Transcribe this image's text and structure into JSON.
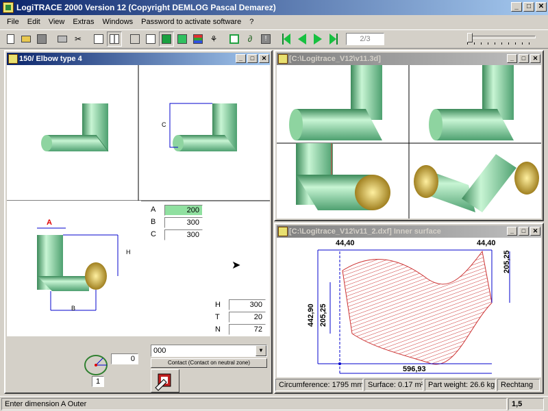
{
  "app": {
    "title": "LogiTRACE 2000  Version 12  (Copyright DEMLOG Pascal Demarez)",
    "window_buttons": {
      "minimize": "_",
      "maximize": "□",
      "close": "✕"
    }
  },
  "menu": [
    "File",
    "Edit",
    "View",
    "Extras",
    "Windows",
    "Password to activate software",
    "?"
  ],
  "toolbar": {
    "page_indicator": "2/3",
    "icons": [
      "new-file-icon",
      "open-folder-icon",
      "save-icon",
      "print-icon",
      "cut-icon",
      "page-view-icon",
      "grid-view-icon",
      "wireframe-cube-icon",
      "cube-icon",
      "shaded-cube-icon",
      "green-cube-icon",
      "colors-icon",
      "tree-icon",
      "frame-icon",
      "curve-icon",
      "info-icon"
    ]
  },
  "windows": {
    "elbow": {
      "title": "150/ Elbow type 4",
      "labels": {
        "c_view": "C",
        "a_view": "A",
        "h_view": "H",
        "b_view": "B"
      },
      "dimensions": [
        {
          "label": "A",
          "value": "200",
          "highlight": true
        },
        {
          "label": "B",
          "value": "300"
        },
        {
          "label": "C",
          "value": "300"
        }
      ],
      "params": [
        {
          "label": "H",
          "value": "300"
        },
        {
          "label": "T",
          "value": "20"
        },
        {
          "label": "N",
          "value": "72"
        }
      ],
      "angle_value": "0",
      "angle_index": "1",
      "combo_value": "000",
      "contact_button": "Contact (Contact on neutral zone)"
    },
    "view3d": {
      "title": "[C:\\Logitrace_V12\\v11.3d]"
    },
    "surface": {
      "title": "[C:\\Logitrace_V12\\v11_2.dxf]  Inner surface",
      "dims": {
        "top_left": "44,40",
        "top_right": "44,40",
        "right": "205,25",
        "left_outer": "442,90",
        "left_inner": "205,25",
        "bottom": "596,93"
      }
    }
  },
  "infobar": {
    "circumference": "Circumference: 1795 mm",
    "surface": "Surface: 0.17 m²",
    "weight": "Part weight: 26.6 kg",
    "shape": "Rechtang"
  },
  "status": {
    "message": "Enter dimension A Outer",
    "position": "1,5"
  },
  "colors": {
    "pipe": "#9ee6b0",
    "pipe_dark": "#3c8a5a",
    "cap": "#e8d060",
    "dim_blue": "#0000cc",
    "hatch_red": "#cc3333"
  }
}
